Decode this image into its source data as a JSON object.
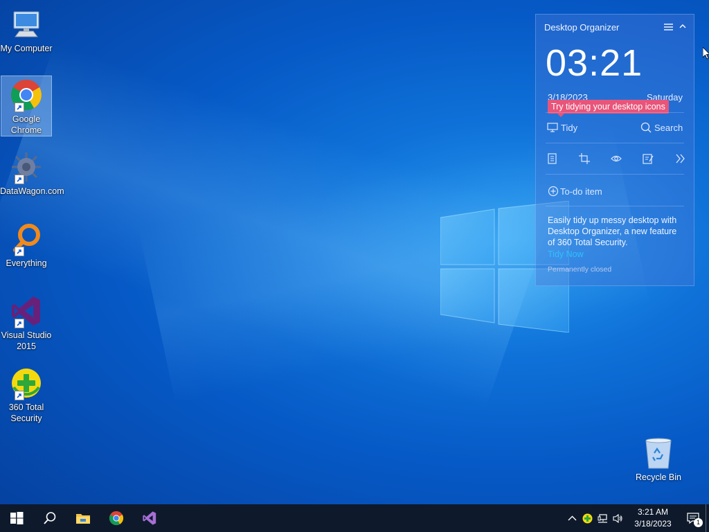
{
  "desktop": {
    "icons": [
      {
        "name": "my-computer",
        "label": "My Computer",
        "icon": "computer-icon"
      },
      {
        "name": "google-chrome",
        "label": "Google Chrome",
        "icon": "chrome-icon",
        "selected": true
      },
      {
        "name": "datawagon",
        "label": "DataWagon.com",
        "icon": "datawagon-icon"
      },
      {
        "name": "everything",
        "label": "Everything",
        "icon": "everything-search-icon"
      },
      {
        "name": "visual-studio",
        "label": "Visual Studio 2015",
        "icon": "visual-studio-icon"
      },
      {
        "name": "360-total-security",
        "label": "360 Total Security",
        "icon": "360-security-icon"
      }
    ],
    "recycle_bin": {
      "label": "Recycle Bin",
      "icon": "recycle-bin-icon"
    }
  },
  "organizer": {
    "title": "Desktop Organizer",
    "time": "03:21",
    "date": "3/18/2023",
    "weekday": "Saturday",
    "tip": "Try tidying your desktop icons",
    "tidy_label": "Tidy",
    "search_label": "Search",
    "todo_label": "To-do item",
    "promo_text": "Easily tidy up messy desktop with Desktop Organizer, a new feature of 360 Total Security.",
    "tidy_now_label": "Tidy Now",
    "permanently_closed_label": "Permanently closed"
  },
  "taskbar": {
    "pinned": [
      "start-icon",
      "search-icon",
      "file-explorer-icon",
      "chrome-icon",
      "visual-studio-icon"
    ],
    "clock_time": "3:21 AM",
    "clock_date": "3/18/2023",
    "notification_count": "1"
  },
  "colors": {
    "tip_bg": "#e8557a",
    "link": "#2fc0ff",
    "taskbar_bg": "#0e1a2c"
  }
}
